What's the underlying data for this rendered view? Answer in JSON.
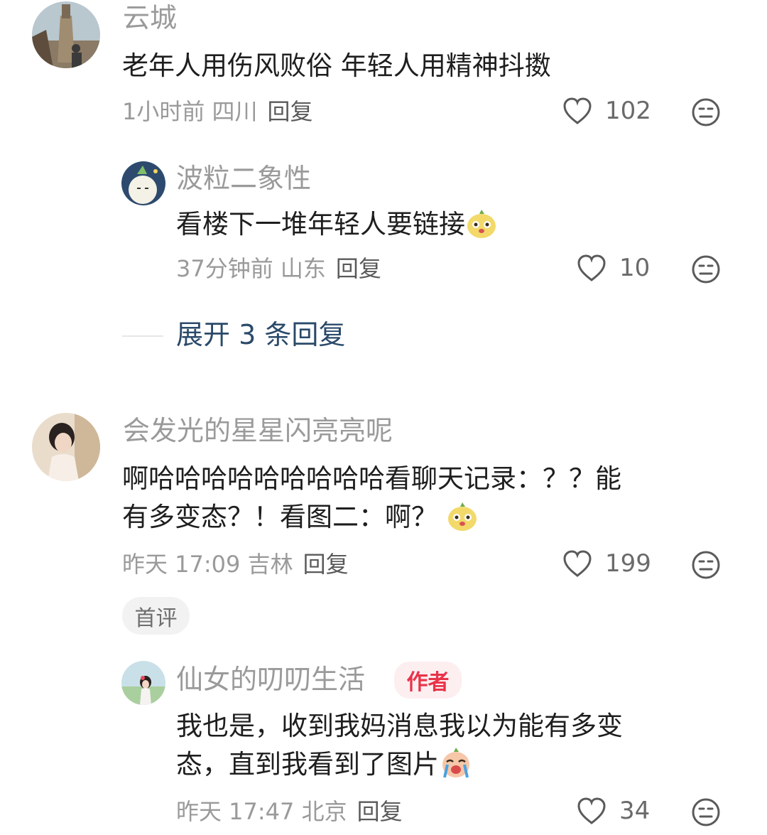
{
  "comments": [
    {
      "username": "云城",
      "text": "老年人用伤风败俗 年轻人用精神抖擞",
      "meta": "1小时前 四川",
      "reply_label": "回复",
      "likes": "102"
    },
    {
      "username": "波粒二象性",
      "text": "看楼下一堆年轻人要链接",
      "meta": "37分钟前 山东",
      "reply_label": "回复",
      "likes": "10"
    },
    {
      "username": "会发光的星星闪亮亮呢",
      "text_line1": "啊哈哈哈哈哈哈哈哈哈看聊天记录：？？能",
      "text_line2": "有多变态？！看图二：啊？",
      "meta": "昨天 17:09 吉林",
      "reply_label": "回复",
      "likes": "199",
      "tag": "首评"
    },
    {
      "username": "仙女的叨叨生活",
      "badge": "作者",
      "text_line1": "我也是，收到我妈消息我以为能有多变",
      "text_line2": "态，直到我看到了图片",
      "meta": "昨天 17:47 北京",
      "reply_label": "回复",
      "likes": "34"
    }
  ],
  "expand_replies": "展开 3 条回复",
  "icons": {
    "like": "heart-outline-icon",
    "dislike": "meh-face-icon",
    "emoji_mascot": "mascot-emoji-icon",
    "emoji_cry": "crying-emoji-icon"
  },
  "colors": {
    "username": "#9a9a9a",
    "text": "#1e1e1e",
    "expand": "#2a4a6a",
    "author_badge": "#e8334a"
  }
}
